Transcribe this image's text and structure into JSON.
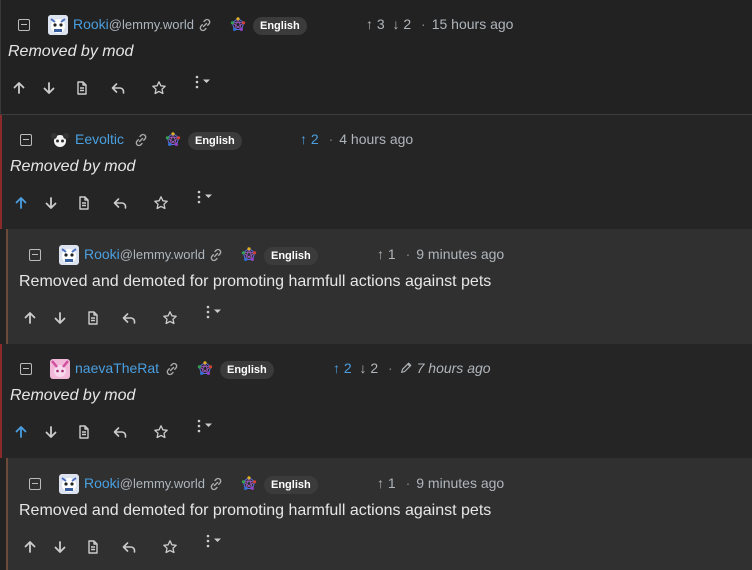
{
  "comments": [
    {
      "username": "Rooki",
      "instance": "@lemmy.world",
      "language": "English",
      "upvotes": "3",
      "downvotes": "2",
      "time": "15 hours ago",
      "body": "Removed by mod"
    },
    {
      "username": "Eevoltic",
      "language": "English",
      "upvotes": "2",
      "time": "4 hours ago",
      "body": "Removed by mod"
    },
    {
      "username": "Rooki",
      "instance": "@lemmy.world",
      "language": "English",
      "upvotes": "1",
      "time": "9 minutes ago",
      "body": "Removed and demoted for promoting harmfull actions against pets"
    },
    {
      "username": "naevaTheRat",
      "language": "English",
      "upvotes": "2",
      "downvotes": "2",
      "time": "7 hours ago",
      "body": "Removed by mod"
    },
    {
      "username": "Rooki",
      "instance": "@lemmy.world",
      "language": "English",
      "upvotes": "1",
      "time": "9 minutes ago",
      "body": "Removed and demoted for promoting harmfull actions against pets"
    }
  ],
  "colors": {
    "accent": "#4a9fe0",
    "background": "#222222",
    "nested_background": "#303030",
    "thread_border": "#8b2a2a"
  },
  "icons": [
    "collapse-icon",
    "avatar",
    "link-icon",
    "fediverse-icon",
    "arrow-up-icon",
    "arrow-down-icon",
    "source-icon",
    "reply-icon",
    "star-icon",
    "more-icon",
    "edit-icon"
  ]
}
